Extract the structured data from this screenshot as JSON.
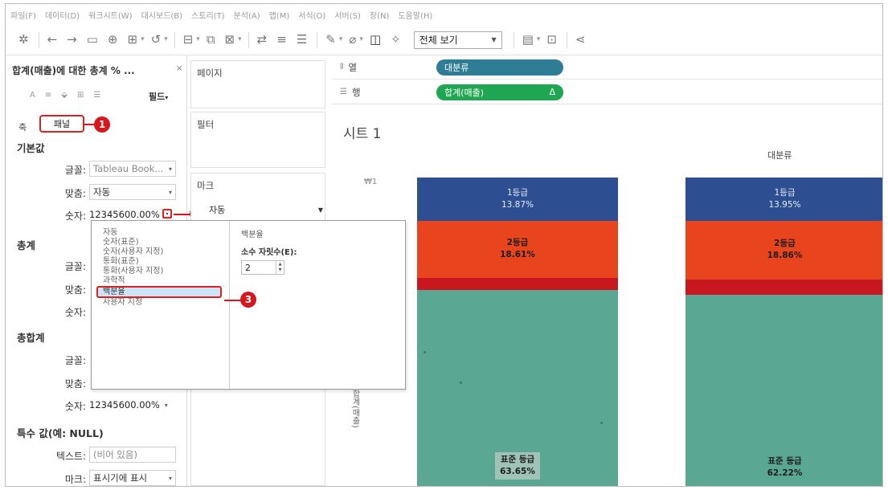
{
  "menu": [
    "파일(F)",
    "데이터(D)",
    "워크시트(W)",
    "대시보드(B)",
    "스토리(T)",
    "분석(A)",
    "맵(M)",
    "서식(O)",
    "서버(S)",
    "창(N)",
    "도움말(H)"
  ],
  "toolbar": {
    "view_select": "전체 보기"
  },
  "left_panel": {
    "title": "합계(매출)에 대한 총계 % ...",
    "close": "×",
    "field_label": "필드",
    "axis_label": "축",
    "panel_tab": "패널",
    "sections": {
      "default": {
        "heading": "기본값",
        "font_label": "글꼴:",
        "font_value": "Tableau Book...",
        "align_label": "맞춤:",
        "align_value": "자동",
        "number_label": "숫자:",
        "number_value": "12345600.00%"
      },
      "total": {
        "heading": "총계",
        "font_label": "글꼴:",
        "align_label": "맞춤:",
        "number_label": "숫자:"
      },
      "grand_total": {
        "heading": "총합계",
        "font_label": "글꼴:",
        "align_label": "맞춤:",
        "number_label": "숫자:",
        "number_value": "12345600.00%"
      },
      "special": {
        "heading": "특수 값(예: NULL)",
        "text_label": "텍스트:",
        "text_placeholder": "(비어 있음)",
        "mark_label": "마크:",
        "mark_value": "표시기에 표시"
      }
    }
  },
  "callouts": [
    "1",
    "2",
    "3"
  ],
  "middle": {
    "pages": "페이지",
    "filters": "필터",
    "marks": "마크",
    "marks_type": "자동"
  },
  "shelves": {
    "columns_label": "열",
    "columns_pill": "대분류",
    "rows_label": "행",
    "rows_pill": "합계(매출)",
    "rows_pill_icon": "Δ"
  },
  "sheet": {
    "title": "시트 1"
  },
  "number_format_popup": {
    "items": [
      "자동",
      "숫자(표준)",
      "숫자(사용자 지정)",
      "통화(표준)",
      "통화(사용자 지정)",
      "과학적",
      "백분율",
      "사용자 지정"
    ],
    "selected_index": 6,
    "right_heading": "백분율",
    "decimal_label": "소수 자릿수(E):",
    "decimal_value": "2"
  },
  "chart_data": {
    "type": "bar",
    "header": "대분류",
    "y_tick": "₩1",
    "y_axis_label": "합계(매출)",
    "colors": {
      "grade1": "#2d4e91",
      "grade2": "#e8441d",
      "red": "#c8171e",
      "standard": "#5aa794"
    },
    "categories": [
      "",
      ""
    ],
    "series": [
      {
        "name": "1등급",
        "values": [
          13.87,
          13.95
        ],
        "labels": [
          "13.87%",
          "13.95%"
        ]
      },
      {
        "name": "2등급",
        "values": [
          18.61,
          18.86
        ],
        "labels": [
          "18.61%",
          "18.86%"
        ]
      },
      {
        "name": "",
        "values": [
          3.87,
          4.97
        ],
        "labels": [
          "",
          ""
        ]
      },
      {
        "name": "표준 등급",
        "values": [
          63.65,
          62.22
        ],
        "labels": [
          "63.65%",
          "62.22%"
        ]
      }
    ]
  }
}
